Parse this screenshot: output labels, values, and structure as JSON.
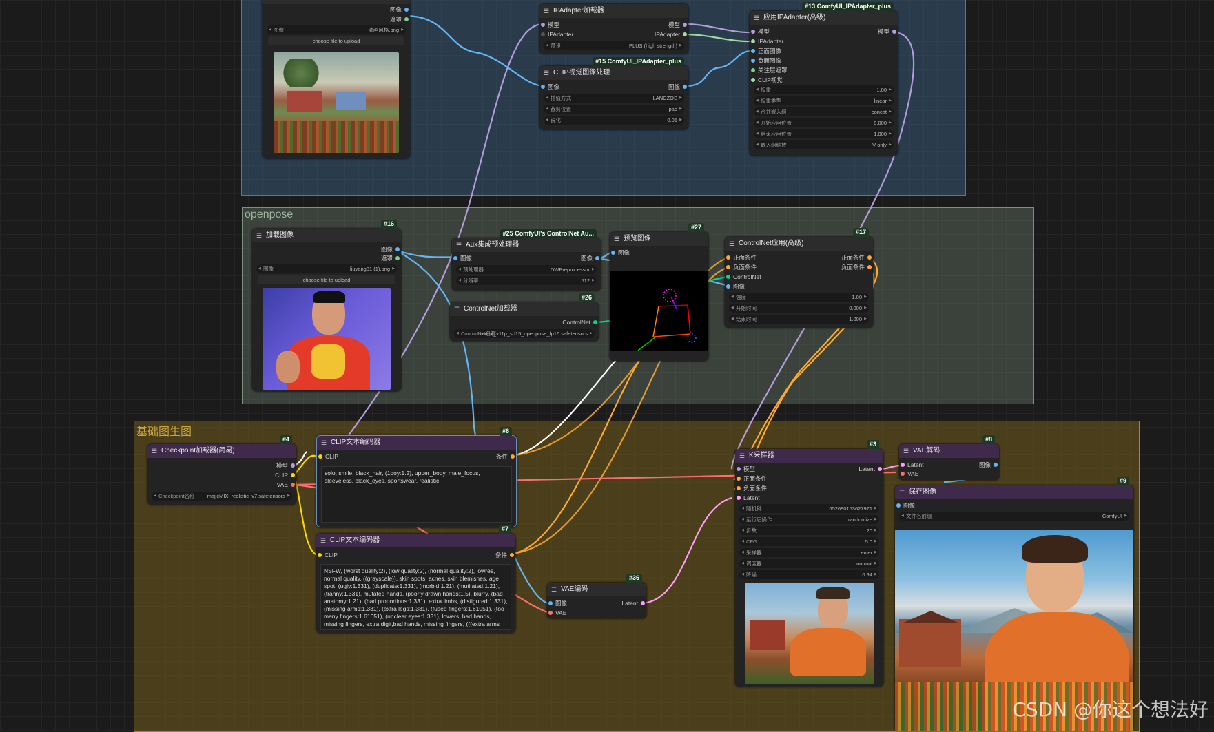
{
  "groups": {
    "openpose": "openpose",
    "base": "基础图生图"
  },
  "nodes": {
    "load_image_top": {
      "outputs": [
        "图像",
        "遮罩"
      ],
      "image_widget": {
        "label": "图像",
        "value": "油画风格.png"
      },
      "upload_label": "choose file to upload"
    },
    "ipadapter_loader": {
      "title": "IPAdapter加载器",
      "outputs": [
        "模型",
        "IPAdapter"
      ],
      "input": "模型",
      "preset": {
        "label": "预设",
        "value": "PLUS (high strength)"
      }
    },
    "clip_vision_prep": {
      "id": "#15 ComfyUI_IPAdapter_plus",
      "title": "CLIP视觉图像处理",
      "input": "图像",
      "output": "图像",
      "widgets": [
        {
          "label": "插值方式",
          "value": "LANCZOS"
        },
        {
          "label": "裁剪位置",
          "value": "pad"
        },
        {
          "label": "锐化",
          "value": "0.05"
        }
      ]
    },
    "apply_ipadapter": {
      "id": "#13 ComfyUI_IPAdapter_plus",
      "title": "应用IPAdapter(高级)",
      "inputs": [
        "模型",
        "IPAdapter",
        "正面图像",
        "负面图像",
        "关注层遮罩",
        "CLIP视觉"
      ],
      "output": "模型",
      "widgets": [
        {
          "label": "权重",
          "value": "1.00"
        },
        {
          "label": "权重类型",
          "value": "linear"
        },
        {
          "label": "合并嵌入组",
          "value": "concat"
        },
        {
          "label": "开始应用位置",
          "value": "0.000"
        },
        {
          "label": "结束应用位置",
          "value": "1.000"
        },
        {
          "label": "嵌入组缩放",
          "value": "V only"
        }
      ]
    },
    "load_image_16": {
      "id": "#16",
      "title": "加载图像",
      "outputs": [
        "图像",
        "遮罩"
      ],
      "image_widget": {
        "label": "图像",
        "value": "liuyang01 (1).png"
      },
      "upload_label": "choose file to upload"
    },
    "aux_preprocessor": {
      "id": "#25 ComfyUI's ControlNet Au...",
      "title": "Aux集成预处理器",
      "input": "图像",
      "output": "图像",
      "widgets": [
        {
          "label": "预处理器",
          "value": "DWPreprocessor"
        },
        {
          "label": "分辨率",
          "value": "512"
        }
      ]
    },
    "controlnet_loader": {
      "id": "#26",
      "title": "ControlNet加载器",
      "output": "ControlNet",
      "widget": {
        "label": "ControlNet名称",
        "value": "control_v11p_sd15_openpose_fp16.safetensors"
      }
    },
    "preview_image": {
      "id": "#27",
      "title": "预览图像",
      "input": "图像"
    },
    "controlnet_apply": {
      "id": "#17",
      "title": "ControlNet应用(高级)",
      "inputs": [
        "正面条件",
        "负面条件",
        "ControlNet",
        "图像"
      ],
      "outputs": [
        "正面条件",
        "负面条件"
      ],
      "widgets": [
        {
          "label": "强度",
          "value": "1.00"
        },
        {
          "label": "开始时间",
          "value": "0.000"
        },
        {
          "label": "结束时间",
          "value": "1.000"
        }
      ]
    },
    "checkpoint_loader": {
      "id": "#4",
      "title": "Checkpoint加载器(简易)",
      "outputs": [
        "模型",
        "CLIP",
        "VAE"
      ],
      "widget": {
        "label": "Checkpoint名称",
        "value": "majicMIX_realistic_v7.safetensors"
      }
    },
    "clip_text_pos": {
      "id": "#6",
      "title": "CLIP文本编码器",
      "input": "CLIP",
      "output": "条件",
      "text": "solo, smile, black_hair, (1boy:1.2), upper_body, male_focus, sleeveless, black_eyes, sportswear, realistic"
    },
    "clip_text_neg": {
      "id": "#7",
      "title": "CLIP文本编码器",
      "input": "CLIP",
      "output": "条件",
      "text": "NSFW, (worst quality:2), (low quality:2), (normal quality:2), lowres, normal quality, ((grayscale)), skin spots, acnes, skin blemishes, age spot, (ugly:1.331), (duplicate:1.331), (morbid:1.21), (mutilated:1.21), (tranny:1.331), mutated hands, (poorly drawn hands:1.5), blurry, (bad anatomy:1.21), (bad proportions:1.331), extra limbs, (disfigured:1.331), (missing arms:1.331), (extra legs:1.331), (fused fingers:1.61051), (too many fingers:1.61051), (unclear eyes:1.331), lowers, bad hands, missing fingers, extra digit,bad hands, missing fingers, (((extra arms and legs)))"
    },
    "vae_encode": {
      "id": "#36",
      "title": "VAE编码",
      "inputs": [
        "图像",
        "VAE"
      ],
      "output": "Latent"
    },
    "ksampler": {
      "id": "#3",
      "title": "K采样器",
      "inputs": [
        "模型",
        "正面条件",
        "负面条件",
        "Latent"
      ],
      "output": "Latent",
      "widgets": [
        {
          "label": "随机种",
          "value": "652690153627971"
        },
        {
          "label": "运行后操作",
          "value": "randomize"
        },
        {
          "label": "步数",
          "value": "20"
        },
        {
          "label": "CFG",
          "value": "5.0"
        },
        {
          "label": "采样器",
          "value": "euler"
        },
        {
          "label": "调度器",
          "value": "normal"
        },
        {
          "label": "降噪",
          "value": "0.94"
        }
      ]
    },
    "vae_decode": {
      "id": "#8",
      "title": "VAE解码",
      "inputs": [
        "Latent",
        "VAE"
      ],
      "output": "图像"
    },
    "save_image": {
      "id": "#9",
      "title": "保存图像",
      "input": "图像",
      "widget": {
        "label": "文件名前缀",
        "value": "ComfyUI"
      }
    }
  },
  "watermark": "CSDN @你这个想法好",
  "colors": {
    "model": "#b39ddb",
    "clip": "#ffd500",
    "vae": "#ff6e6e",
    "image": "#64b5f6",
    "conditioning": "#ffa931",
    "latent": "#ff9cf9",
    "controlnet": "#00d78d",
    "ipadapter": "#a3d9a5",
    "white_wire": "#ffffff"
  }
}
